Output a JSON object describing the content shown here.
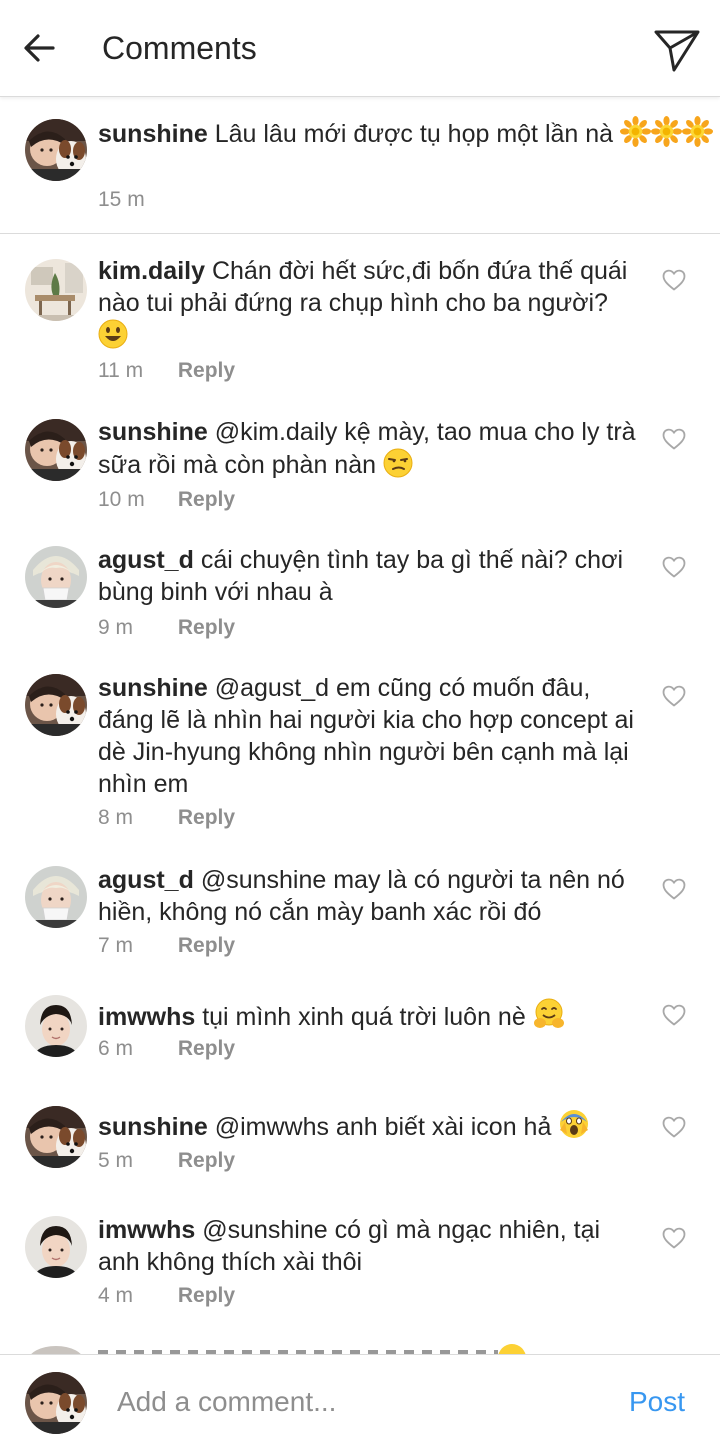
{
  "header": {
    "title": "Comments",
    "back_icon": "arrow-left-icon",
    "send_icon": "paper-plane-icon"
  },
  "caption": {
    "username": "sunshine",
    "text": "Lâu lâu mới được tụ họp một lần nà",
    "time": "15 m"
  },
  "reply_label": "Reply",
  "comments": [
    {
      "username": "kim.daily",
      "text": "Chán đời hết sức,đi bốn đứa thế quái nào tui phải đứng ra chụp hình cho ba người?",
      "time": "11 m"
    },
    {
      "username": "sunshine",
      "text": "@kim.daily kệ mày, tao mua cho ly trà sữa rồi mà còn phàn nàn",
      "time": "10 m"
    },
    {
      "username": "agust_d",
      "text": "cái chuyện tình tay ba gì thế nài? chơi bùng binh với nhau à",
      "time": "9 m"
    },
    {
      "username": "sunshine",
      "text": "@agust_d em cũng có muốn đâu, đáng lẽ là nhìn hai người kia cho hợp concept ai dè Jin-hyung không nhìn người bên cạnh mà lại nhìn em",
      "time": "8 m"
    },
    {
      "username": "agust_d",
      "text": "@sunshine may là có người ta nên nó hiền, không nó cắn mày banh xác rồi đó",
      "time": "7 m"
    },
    {
      "username": "imwwhs",
      "text": "tụi mình xinh quá trời luôn nè",
      "time": "6 m"
    },
    {
      "username": "sunshine",
      "text": "@imwwhs anh biết xài icon hả",
      "time": "5 m"
    },
    {
      "username": "imwwhs",
      "text": "@sunshine có gì mà ngạc nhiên, tại anh không thích xài thôi",
      "time": "4 m"
    }
  ],
  "footer": {
    "placeholder": "Add a comment...",
    "post_label": "Post"
  }
}
